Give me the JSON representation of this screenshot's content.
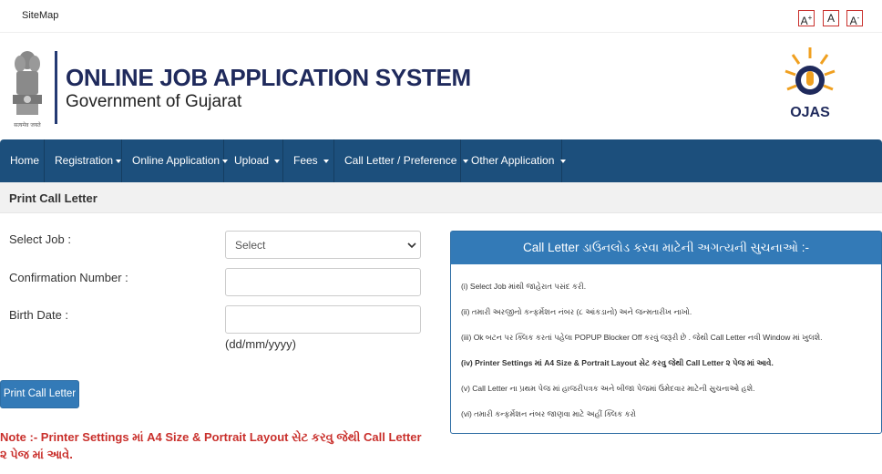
{
  "topbar": {
    "sitemap": "SiteMap",
    "font_increase": "A",
    "font_increase_sup": "+",
    "font_normal": "A",
    "font_decrease": "A",
    "font_decrease_sup": "-"
  },
  "header": {
    "title": "ONLINE JOB APPLICATION SYSTEM",
    "subtitle": "Government of Gujarat",
    "emblem_motto": "सत्यमेव जयते",
    "ojas_logo_text": "OJAS"
  },
  "nav": {
    "items": [
      {
        "label": "Home"
      },
      {
        "label": "Registration"
      },
      {
        "label": "Online Application"
      },
      {
        "label": "Upload"
      },
      {
        "label": "Fees"
      },
      {
        "label": "Call Letter / Preference"
      },
      {
        "label": "Other Application"
      }
    ]
  },
  "page": {
    "title": "Print Call Letter"
  },
  "form": {
    "select_job_label": "Select Job :",
    "select_job_value": "Select",
    "confirmation_label": "Confirmation Number :",
    "confirmation_value": "",
    "birth_date_label": "Birth Date :",
    "birth_date_value": "",
    "birth_date_hint": "(dd/mm/yyyy)",
    "print_button": "Print Call Letter"
  },
  "note": "Note :- Printer Settings માં A4 Size & Portrait Layout સેટ કરવુ જેથી Call Letter ૨ પેજ માં આવે.",
  "instructions": {
    "heading": "Call Letter ડાઉનલોડ કરવા માટેની અગત્યની સુચનાઓ :-",
    "items": [
      "(i) Select Job માંથી જાહેરાત પસંદ કરી.",
      "(ii) તમારી અરજીનો કન્ફર્મેશન નંબર (૮ આંકડાનો) અને જન્મતારીખ નાખો.",
      "(iii) Ok બટન પર ક્લિક કરતાં પહેલા POPUP Blocker Off કરવું જરૂરી છે . જેથી Call Letter નવી Window માં ખુલશે.",
      "(iv) Printer Settings માં A4 Size & Portrait Layout સેટ કરવુ જેથી Call Letter ૨ પેજ માં આવે.",
      "(v) Call Letter ના પ્રથમ પેજ માં હાજરીપત્રક અને બીજા પેજમાં ઉમેદવાર માટેની સુચનાઓ હશે.",
      "(vi) તમારી કન્ફર્મેશન નંબર જાણવા માટે અહીં ક્લિક કરો"
    ]
  },
  "colors": {
    "navbar": "#1c4f7c",
    "primary": "#337ab7",
    "title": "#1f2a5c",
    "note": "#c9302c"
  }
}
